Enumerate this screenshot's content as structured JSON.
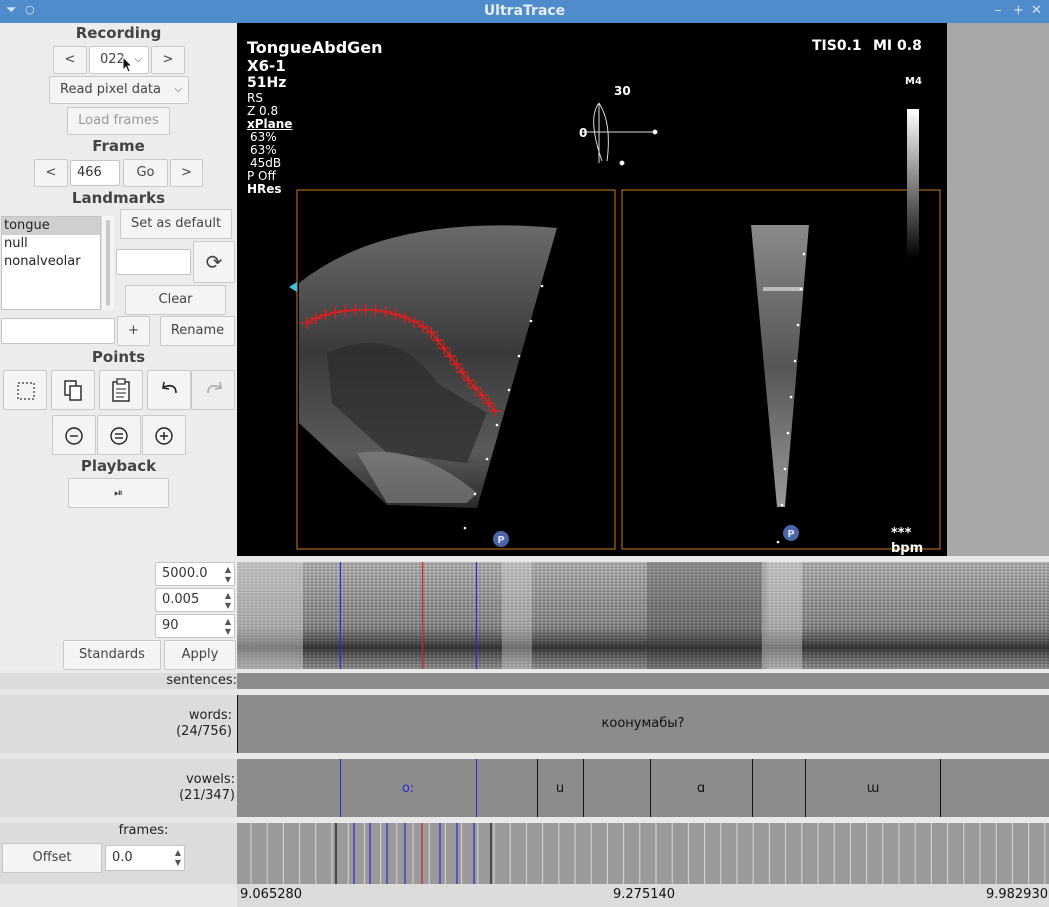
{
  "window": {
    "title": "UltraTrace"
  },
  "recording": {
    "title": "Recording",
    "prev_label": "<",
    "next_label": ">",
    "selected": "022",
    "read_mode": "Read pixel data",
    "load_frames": "Load frames"
  },
  "frame": {
    "title": "Frame",
    "prev_label": "<",
    "value": "466",
    "go_label": "Go",
    "next_label": ">"
  },
  "landmarks": {
    "title": "Landmarks",
    "items": [
      "tongue",
      "null",
      "nonalveolar"
    ],
    "set_default": "Set as default",
    "clear": "Clear",
    "add_label": "+",
    "rename": "Rename"
  },
  "points": {
    "title": "Points"
  },
  "playback": {
    "title": "Playback",
    "play_symbol": "⏯"
  },
  "ultrasound": {
    "probe": "TongueAbdGen",
    "transducer": "X6-1",
    "rate": "51Hz",
    "params": [
      "RS",
      "Z 0.8",
      "xPlane",
      "63%",
      "63%",
      "45dB",
      "P Off",
      "HRes"
    ],
    "tis": "TIS0.1",
    "mi": "MI 0.8",
    "angle_top": "30",
    "angle_left": "0",
    "scale_label": "M4",
    "bpm": "*** bpm",
    "marker": "P"
  },
  "spectrogram_settings": {
    "max_freq": "5000.0",
    "window_len": "0.005",
    "dynamic_range": "90",
    "standards": "Standards",
    "apply": "Apply"
  },
  "tiers": {
    "sentences": {
      "label": "sentences:"
    },
    "words": {
      "label": "words:",
      "count": "(24/756)",
      "text": "коонумабы?"
    },
    "vowels": {
      "label": "vowels:",
      "count": "(21/347)",
      "segments": [
        {
          "text": "o:",
          "color": "#2a2ad8"
        },
        {
          "text": "u",
          "color": "#111111"
        },
        {
          "text": "ɑ",
          "color": "#111111"
        },
        {
          "text": "ɯ",
          "color": "#111111"
        }
      ]
    },
    "frames": {
      "label": "frames:",
      "offset_label": "Offset",
      "offset_value": "0.0"
    }
  },
  "timeline": {
    "start": "9.065280",
    "cursor": "9.275140",
    "end": "9.982930"
  },
  "colors": {
    "titlebar": "#4f8ccc",
    "trace": "#e11d1d",
    "selection": "#2a2ad8",
    "tier": "#8c8c8c"
  }
}
